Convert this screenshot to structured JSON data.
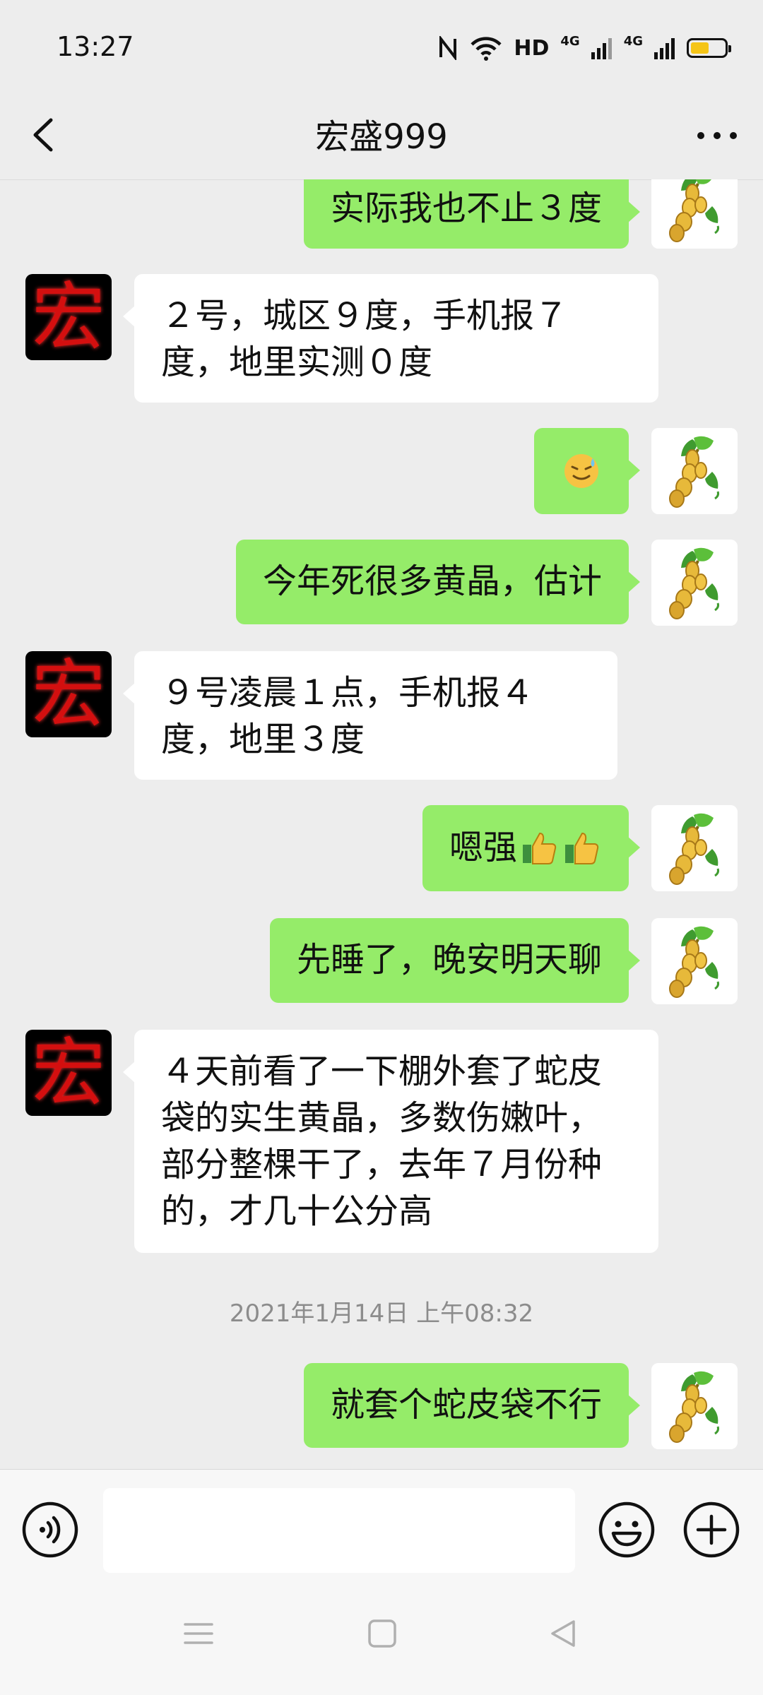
{
  "status_bar": {
    "time": "13:27",
    "hd": "HD",
    "net1": "4G",
    "net2": "4G",
    "battery_level": 0.55,
    "battery_color": "#f5c518"
  },
  "header": {
    "title": "宏盛999",
    "back_icon": "chevron-left-icon",
    "more_icon": "more-dots-icon"
  },
  "messages": [
    {
      "side": "out",
      "text": "实际我也不止３度"
    },
    {
      "side": "in",
      "text": "２号，城区９度，手机报７度，地里实测０度"
    },
    {
      "side": "out",
      "emoji": "sweat-smile-emoji"
    },
    {
      "side": "out",
      "text": "今年死很多黄晶，估计"
    },
    {
      "side": "in",
      "text": "９号凌晨１点，手机报４度，地里３度"
    },
    {
      "side": "out",
      "text": "嗯强",
      "emoji": "thumbs-up-emoji"
    },
    {
      "side": "out",
      "text": "先睡了，晚安明天聊"
    },
    {
      "side": "in",
      "text": "４天前看了一下棚外套了蛇皮袋的实生黄晶，多数伤嫩叶，部分整棵干了，去年７月份种的，才几十公分高"
    },
    {
      "side": "out",
      "text": "就套个蛇皮袋不行"
    }
  ],
  "contact_avatar_text": "宏",
  "timestamp": "2021年1月14日 上午08:32",
  "colors": {
    "outgoing_bubble": "#95ec69",
    "incoming_bubble": "#ffffff",
    "background": "#ededed"
  },
  "input_bar": {
    "voice_icon": "voice-icon",
    "emoji_icon": "emoji-icon",
    "plus_icon": "plus-icon"
  },
  "nav_bar": {
    "menu_icon": "menu-icon",
    "home_icon": "home-square-icon",
    "back_icon": "back-triangle-icon"
  }
}
